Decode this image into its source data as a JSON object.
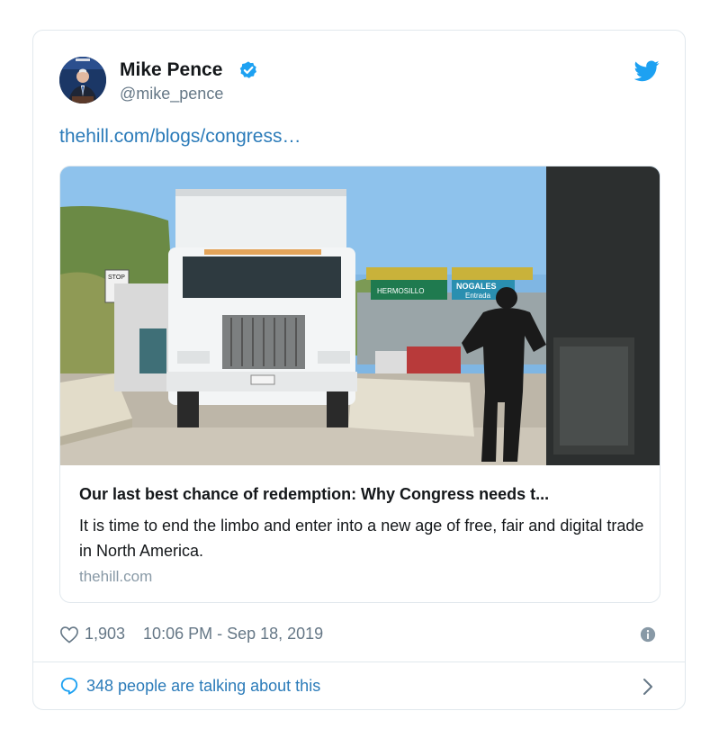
{
  "author": {
    "name": "Mike Pence",
    "handle": "@mike_pence"
  },
  "tweet": {
    "link_text": "thehill.com/blogs/congress…"
  },
  "card": {
    "title": "Our last best chance of redemption: Why Congress needs t...",
    "description": "It is time to end the limbo and enter into a new age of free, fair and digital trade in North America.",
    "domain": "thehill.com",
    "image_signs": {
      "stop": "STOP",
      "hermosillo": "HERMOSILLO",
      "nogales": "NOGALES",
      "entrada": "Entrada"
    }
  },
  "meta": {
    "likes": "1,903",
    "timestamp": "10:06 PM - Sep 18, 2019"
  },
  "footer": {
    "talking": "348 people are talking about this"
  },
  "icons": {
    "verified": "verified-badge-icon",
    "bird": "twitter-bird-icon",
    "heart": "heart-icon",
    "info": "info-icon",
    "bubble": "speech-bubble-icon",
    "chevron": "chevron-right-icon"
  },
  "colors": {
    "twitter_blue": "#1da1f2",
    "link": "#2b7bb9",
    "secondary_text": "#657786",
    "border": "#e1e8ed"
  }
}
